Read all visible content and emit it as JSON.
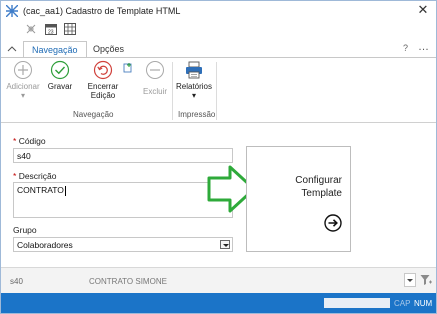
{
  "window": {
    "title": "(cac_aa1) Cadastro de Template HTML",
    "close_label": "✕"
  },
  "quick_access": {
    "icons": [
      "pin-icon",
      "calendar-icon",
      "grid-icon"
    ]
  },
  "ribbon": {
    "tabs": [
      {
        "label": "Navegação",
        "active": true
      },
      {
        "label": "Opções",
        "active": false
      }
    ],
    "help_label": "?",
    "more_label": "…",
    "buttons": {
      "adicionar": {
        "label": "Adicionar",
        "sub": "▾",
        "enabled": false
      },
      "gravar": {
        "label": "Gravar",
        "enabled": true
      },
      "encerrar": {
        "label": "Encerrar Edição",
        "line1": "Encerrar",
        "line2": "Edição",
        "enabled": true
      },
      "excluir": {
        "label": "Excluir",
        "enabled": false
      },
      "relatorios": {
        "label": "Relatórios",
        "sub": "▾",
        "enabled": true
      }
    },
    "groups": {
      "navegacao": "Navegação",
      "impressao": "Impressão"
    }
  },
  "form": {
    "codigo": {
      "label": "Código",
      "required_mark": "*",
      "value": "s40"
    },
    "descricao": {
      "label": "Descrição",
      "required_mark": "*",
      "value": "CONTRATO"
    },
    "grupo": {
      "label": "Grupo",
      "value": "Colaboradores"
    },
    "config": {
      "line1": "Configurar",
      "line2": "Template"
    }
  },
  "record_bar": {
    "code": "s40",
    "description": "CONTRATO SIMONE"
  },
  "status_bar": {
    "cap": "CAP",
    "num": "NUM"
  },
  "colors": {
    "accent": "#1b74c8",
    "tab_active_text": "#1f6bb5",
    "arrow_green": "#2eaa3a",
    "required": "#c00000"
  }
}
